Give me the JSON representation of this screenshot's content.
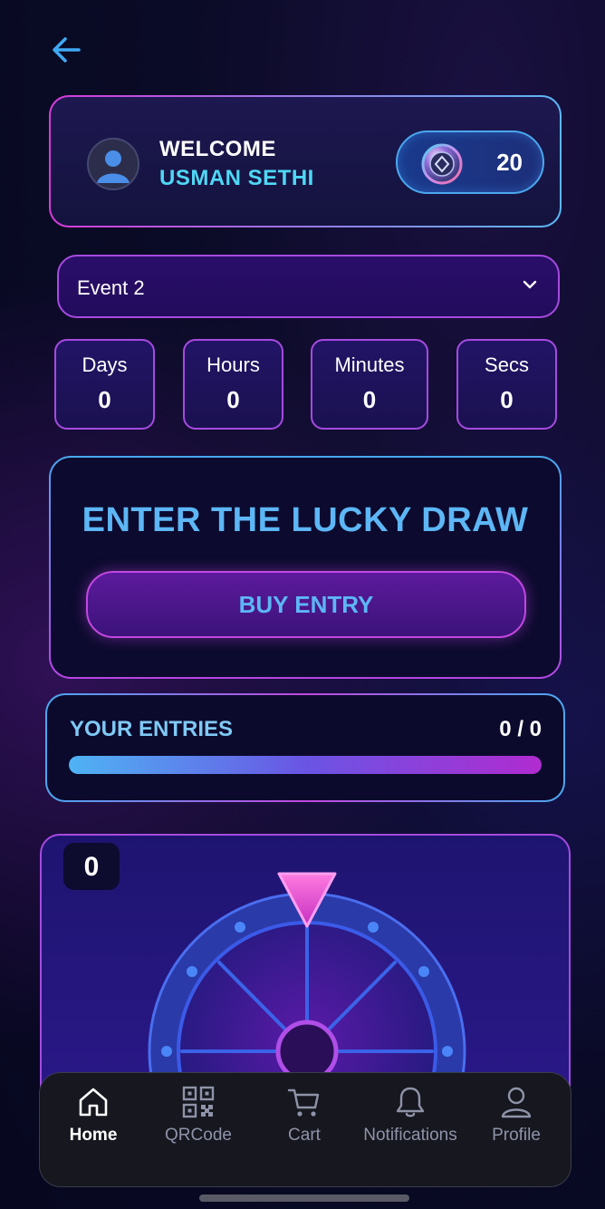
{
  "header": {
    "back_icon": "arrow-left-icon"
  },
  "welcome": {
    "label": "WELCOME",
    "name": "USMAN SETHI",
    "avatar_icon": "user-avatar-icon",
    "coins": {
      "icon": "coin-icon",
      "count": "20"
    }
  },
  "event": {
    "selected": "Event 2",
    "dropdown_icon": "chevron-down-icon"
  },
  "countdown": [
    {
      "label": "Days",
      "value": "0"
    },
    {
      "label": "Hours",
      "value": "0"
    },
    {
      "label": "Minutes",
      "value": "0"
    },
    {
      "label": "Secs",
      "value": "0"
    }
  ],
  "draw": {
    "title": "ENTER THE LUCKY DRAW",
    "button_label": "BUY ENTRY"
  },
  "entries": {
    "label": "YOUR ENTRIES",
    "count": "0 / 0"
  },
  "wheel": {
    "counter": "0",
    "pointer_icon": "triangle-pointer-icon"
  },
  "nav": {
    "items": [
      {
        "label": "Home",
        "icon": "home-icon",
        "active": true
      },
      {
        "label": "QRCode",
        "icon": "qr-code-icon",
        "active": false
      },
      {
        "label": "Cart",
        "icon": "cart-icon",
        "active": false
      },
      {
        "label": "Notifications",
        "icon": "bell-icon",
        "active": false
      },
      {
        "label": "Profile",
        "icon": "profile-icon",
        "active": false
      }
    ]
  },
  "colors": {
    "accent_cyan": "#4fd8f5",
    "accent_blue": "#5db6f5",
    "accent_magenta": "#c247e0",
    "background": "#0a0b26"
  }
}
